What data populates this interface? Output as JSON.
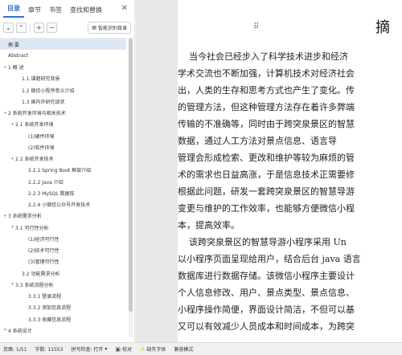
{
  "sidebar": {
    "tabs": [
      {
        "label": "目录",
        "active": true
      },
      {
        "label": "章节",
        "active": false
      },
      {
        "label": "书签",
        "active": false
      },
      {
        "label": "查找和替换",
        "active": false
      }
    ],
    "close_icon": "close-icon",
    "toolbar": {
      "collapse": "⌄",
      "expand": "⌃",
      "add": "+",
      "remove": "−",
      "smart_label": "智能识别目录"
    },
    "outline": [
      {
        "text": "摘  要",
        "level": 0,
        "caret": "",
        "selected": true
      },
      {
        "text": "Abstract",
        "level": 0,
        "caret": ""
      },
      {
        "text": "1 概  述",
        "level": 0,
        "caret": "▾"
      },
      {
        "text": "1.1 课题研究背景",
        "level": 2,
        "caret": ""
      },
      {
        "text": "1.2 微信小程序意义介绍",
        "level": 2,
        "caret": ""
      },
      {
        "text": "1.3 国内外研究现状",
        "level": 2,
        "caret": ""
      },
      {
        "text": "2 系统开发环境与相关技术",
        "level": 0,
        "caret": "▾"
      },
      {
        "text": "2.1 系统开发环境",
        "level": 1,
        "caret": "▾"
      },
      {
        "text": "(1)硬件环境",
        "level": 3,
        "caret": ""
      },
      {
        "text": "(2)软件环境",
        "level": 3,
        "caret": ""
      },
      {
        "text": "2.2 系统开发技术",
        "level": 1,
        "caret": "▾"
      },
      {
        "text": "2.2.1 Spring Boot 框架介绍",
        "level": 3,
        "caret": ""
      },
      {
        "text": "2.2.2 Java 介绍",
        "level": 3,
        "caret": ""
      },
      {
        "text": "2.2.3 MySQL 数据库",
        "level": 3,
        "caret": ""
      },
      {
        "text": "2.2.4 小微信公众号开发技术",
        "level": 3,
        "caret": ""
      },
      {
        "text": "3 系统需求分析",
        "level": 0,
        "caret": "▾"
      },
      {
        "text": "3.1 可行性分析",
        "level": 1,
        "caret": "▾"
      },
      {
        "text": "(1)经济可行性",
        "level": 3,
        "caret": ""
      },
      {
        "text": "(2)技术可行性",
        "level": 3,
        "caret": ""
      },
      {
        "text": "(3)管理可行性",
        "level": 3,
        "caret": ""
      },
      {
        "text": "3.2 功能需求分析",
        "level": 2,
        "caret": ""
      },
      {
        "text": "3.3 系统流程分析",
        "level": 1,
        "caret": "▾"
      },
      {
        "text": "3.3.1 登录流程",
        "level": 3,
        "caret": ""
      },
      {
        "text": "3.3.2 添加信息流程",
        "level": 3,
        "caret": ""
      },
      {
        "text": "3.3.3 收藏信息流程",
        "level": 3,
        "caret": ""
      },
      {
        "text": "4 系统设计",
        "level": 0,
        "caret": "▾"
      }
    ]
  },
  "document": {
    "drag_handle": "⠿",
    "title": "摘",
    "lines": [
      "    当今社会已经步入了科学技术进步和经济",
      "学术交流也不断加强，计算机技术对经济社会",
      "出，人类的生存和思考方式也产生了变化。传",
      "的管理方法，但这种管理方法存在着许多弊端",
      "传输的不准确等，同时由于跨突泉景区的智慧",
      "数据，通过人工方法对景点信息、语言导",
      "管理会形成检索、更改和维护等较为麻烦的管",
      "术的需求也日益高涨，于是信息技术正需要修",
      "根据此问题，研发一套跨突泉景区的智慧导游",
      "变更与维护的工作效率，也能够方便微信小程",
      "本，提高效率。",
      "    该跨突泉景区的智慧导游小程序采用 Un",
      "以小程序页面呈现给用户，结合后台 java 语言",
      "数据库进行数据存储。该微信小程序主要设计",
      "个人信息修改、用户、景点类型、景点信息、",
      "小程序操作简便，界面设计简洁，不但可以基",
      "又可以有效减少人员成本和时间成本，为跨突"
    ]
  },
  "statusbar": {
    "page": "页面: 1/51",
    "words": "字数: 11553",
    "spell": "拼写检查: 打开",
    "spell_caret": "▾",
    "proof": "校对",
    "missing_font": "缺失字体",
    "compat": "兼容模式"
  }
}
